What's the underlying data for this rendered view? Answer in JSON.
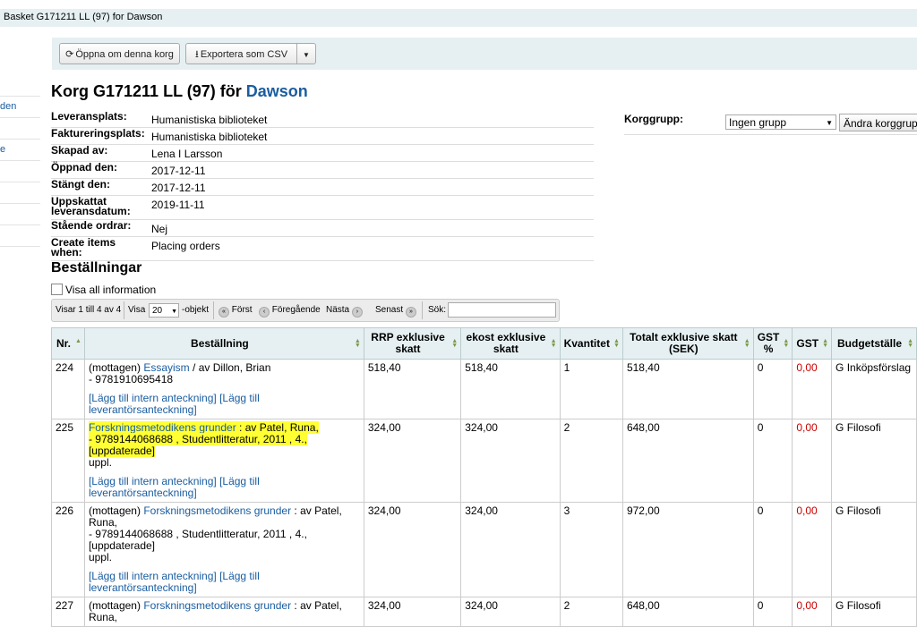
{
  "breadcrumb": "Basket G171211 LL (97) for Dawson",
  "toolbar": {
    "reopen_label": "Öppna om denna korg",
    "export_label": "Exportera som CSV"
  },
  "left_nav": [
    "",
    "den",
    "",
    "e",
    "",
    "",
    "",
    ""
  ],
  "page_title": {
    "prefix": "Korg G171211 LL (97) för",
    "vendor": "Dawson"
  },
  "info": [
    {
      "label": "Leveransplats:",
      "value": "Humanistiska biblioteket"
    },
    {
      "label": "Faktureringsplats:",
      "value": "Humanistiska biblioteket"
    },
    {
      "label": "Skapad av:",
      "value": "Lena I Larsson"
    },
    {
      "label": "Öppnad den:",
      "value": "2017-12-11"
    },
    {
      "label": "Stängt den:",
      "value": "2017-12-11"
    },
    {
      "label": "Uppskattat leveransdatum:",
      "value": "2019-11-11"
    },
    {
      "label": "Stående ordrar:",
      "value": "Nej"
    },
    {
      "label": "Create items when:",
      "value": "Placing orders"
    }
  ],
  "group": {
    "label": "Korggrupp:",
    "selected": "Ingen grupp",
    "change_button": "Ändra korggrupp"
  },
  "orders_heading": "Beställningar",
  "show_all_label": "Visa all information",
  "pager": {
    "showing": "Visar 1 till 4 av 4",
    "show_label": "Visa",
    "per_page": "20",
    "objects_label": "-objekt",
    "first": "Först",
    "previous": "Föregående",
    "next": "Nästa",
    "last": "Senast",
    "search_label": "Sök:"
  },
  "table": {
    "headers": [
      "Nr.",
      "Beställning",
      "RRP exklusive skatt",
      "ekost exklusive skatt",
      "Kvantitet",
      "Totalt exklusive skatt (SEK)",
      "GST %",
      "GST",
      "Budgetställe"
    ],
    "note_internal": "[Lägg till intern anteckning]",
    "note_vendor": "[Lägg till leverantörsanteckning]",
    "rows": [
      {
        "nr": "224",
        "status": "(mottagen)",
        "title": "Essayism",
        "sep": "/",
        "author": "av Dillon, Brian",
        "line2": "- 9781910695418",
        "line3": "",
        "rrp": "518,40",
        "ecost": "518,40",
        "qty": "1",
        "total": "518,40",
        "gst_pct": "0",
        "gst": "0,00",
        "fund": "G Inköpsförslag"
      },
      {
        "nr": "225",
        "status": "",
        "title": "Forskningsmetodikens grunder",
        "sep": ":",
        "author": "av Patel, Runa,",
        "line2": "- 9789144068688 , Studentlitteratur, 2011 , 4., [uppdaterade]",
        "line3": "uppl.",
        "rrp": "324,00",
        "ecost": "324,00",
        "qty": "2",
        "total": "648,00",
        "gst_pct": "0",
        "gst": "0,00",
        "fund": "G Filosofi"
      },
      {
        "nr": "226",
        "status": "(mottagen)",
        "title": "Forskningsmetodikens grunder",
        "sep": ":",
        "author": "av Patel, Runa,",
        "line2": "- 9789144068688 , Studentlitteratur, 2011 , 4., [uppdaterade]",
        "line3": "uppl.",
        "rrp": "324,00",
        "ecost": "324,00",
        "qty": "3",
        "total": "972,00",
        "gst_pct": "0",
        "gst": "0,00",
        "fund": "G Filosofi"
      },
      {
        "nr": "227",
        "status": "(mottagen)",
        "title": "Forskningsmetodikens grunder",
        "sep": ":",
        "author": "av Patel, Runa,",
        "line2": "",
        "line3": "",
        "rrp": "324,00",
        "ecost": "324,00",
        "qty": "2",
        "total": "648,00",
        "gst_pct": "0",
        "gst": "0,00",
        "fund": "G Filosofi"
      }
    ]
  },
  "colors": {
    "link": "#1a5da0",
    "highlight": "#ffff33",
    "header_bg": "#e6f0f2",
    "zero": "#cc0000"
  }
}
